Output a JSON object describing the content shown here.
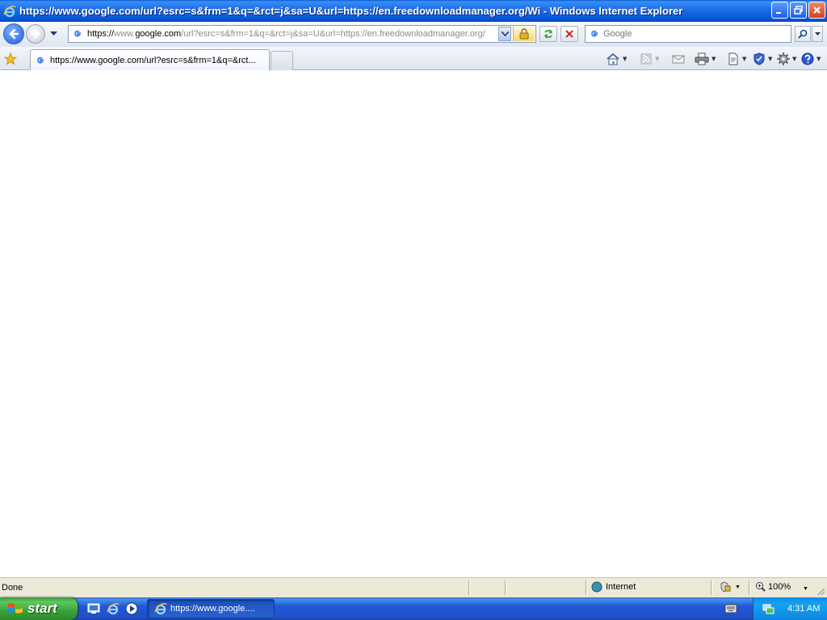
{
  "window": {
    "title": "https://www.google.com/url?esrc=s&frm=1&q=&rct=j&sa=U&url=https://en.freedownloadmanager.org/Wi - Windows Internet Explorer"
  },
  "address_bar": {
    "url_host_prefix": "https://",
    "url_host_dim1": "www.",
    "url_host": "google.com",
    "url_rest": "/url?esrc=s&frm=1&q=&rct=j&sa=U&url=https://en.freedownloadmanager.org/"
  },
  "search_box": {
    "placeholder": "Google"
  },
  "tab": {
    "label": "https://www.google.com/url?esrc=s&frm=1&q=&rct..."
  },
  "status_bar": {
    "status_text": "Done",
    "zone": "Internet",
    "zoom": "100%"
  },
  "taskbar": {
    "start_label": "start",
    "task_label": "https://www.google....",
    "clock": "4:31 AM"
  },
  "colors": {
    "title_bar": "#0553d6",
    "taskbar": "#2157d7",
    "start_button": "#3aa23a",
    "tray": "#0f8ae6"
  }
}
